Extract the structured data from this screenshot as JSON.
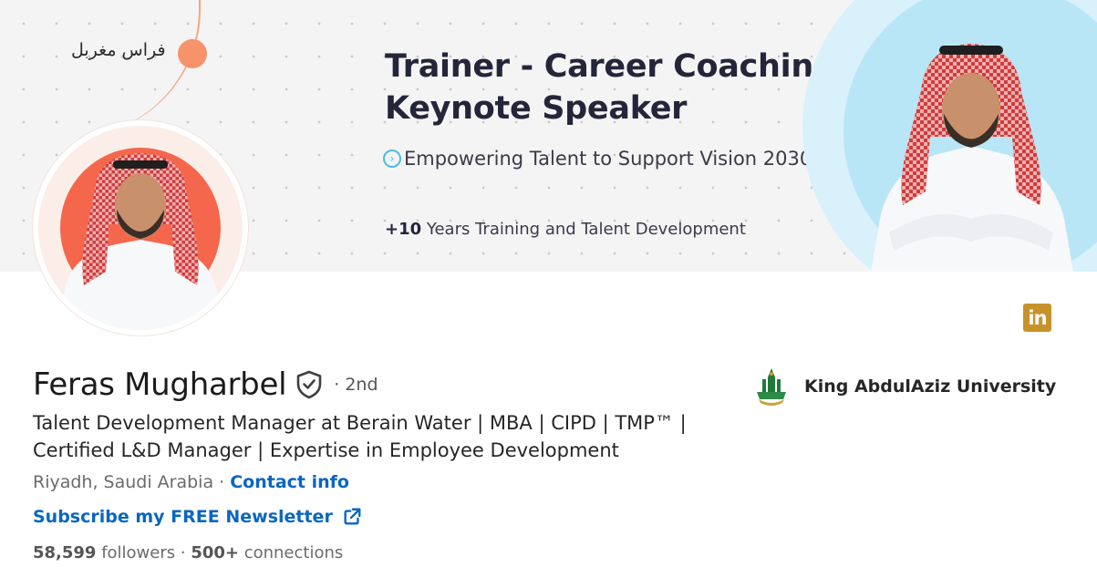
{
  "banner": {
    "arabic_name": "فراس مغربل",
    "title_line1": "Trainer - Career Coaching",
    "title_line2": "Keynote Speaker",
    "tagline": "Empowering Talent to Support Vision 2030",
    "years_prefix": "+10",
    "years_text": " Years Training and Talent Development",
    "colors": {
      "accent_orange": "#f7926a",
      "accent_blue": "#4fbde0"
    }
  },
  "profile": {
    "name": "Feras Mugharbel",
    "degree": "· 2nd",
    "headline_line1": "Talent Development Manager at Berain Water | MBA | CIPD | TMP™ |",
    "headline_line2": "Certified L&D Manager | Expertise in Employee Development",
    "location": "Riyadh, Saudi Arabia",
    "location_separator": " · ",
    "contact_info": "Contact info",
    "newsletter": "Subscribe my FREE Newsletter",
    "followers_count": "58,599",
    "followers_label": " followers",
    "connections_separator": "  · ",
    "connections_count": "500+",
    "connections_label": " connections"
  },
  "education": {
    "name": "King AbdulAziz University"
  },
  "social": {
    "linkedin_badge": "in",
    "linkedin_color": "#c8922a"
  },
  "colors": {
    "link_blue": "#0a66c2"
  }
}
